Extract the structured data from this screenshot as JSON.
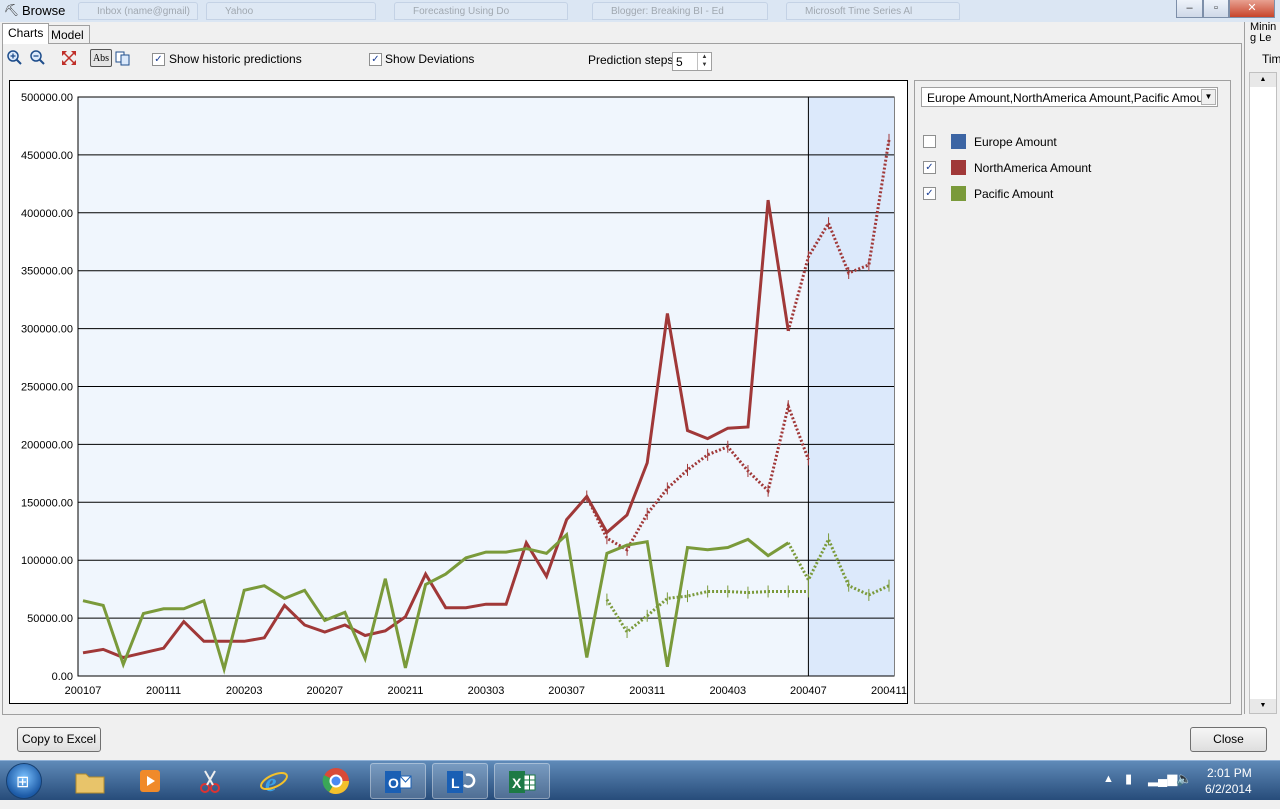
{
  "window": {
    "title": "Browse",
    "app_icon": "pickaxe-icon"
  },
  "background_tabs": [
    "Inbox (name@gmail)",
    "Yahoo",
    "Forecasting Using Do",
    "Blogger: Breaking BI - Ed",
    "Microsoft Time Series Al"
  ],
  "window_buttons": {
    "minimize": "–",
    "maximize": "▫",
    "close": "✕"
  },
  "tabs": [
    {
      "label": "Charts",
      "active": true
    },
    {
      "label": "Model",
      "active": false
    }
  ],
  "toolbar": {
    "zoom_in_icon": "zoom-in-icon",
    "zoom_out_icon": "zoom-out-icon",
    "fit_icon": "fit-icon",
    "abs_label": "Abs",
    "copy_icon": "copy-icon",
    "show_historic_label": "Show historic predictions",
    "show_historic_checked": true,
    "show_deviations_label": "Show Deviations",
    "show_deviations_checked": true,
    "prediction_steps_label": "Prediction steps",
    "prediction_steps_value": "5"
  },
  "legend": {
    "selector_value": "Europe Amount,NorthAmerica Amount,Pacific Amount",
    "items": [
      {
        "label": "Europe Amount",
        "checked": false,
        "color": "#3c65a4"
      },
      {
        "label": "NorthAmerica Amount",
        "checked": true,
        "color": "#a03838"
      },
      {
        "label": "Pacific Amount",
        "checked": true,
        "color": "#7a9a3a"
      }
    ]
  },
  "mini_panel": {
    "title_line1": "Minin",
    "title_line2": "g Le",
    "label": "Tim"
  },
  "buttons": {
    "copy_to_excel": "Copy to Excel",
    "close": "Close"
  },
  "taskbar": {
    "apps": [
      "explorer",
      "media-player",
      "snipping-tool",
      "internet-explorer",
      "chrome",
      "outlook",
      "lync",
      "excel"
    ],
    "time": "2:01 PM",
    "date": "6/2/2014"
  },
  "chart_data": {
    "type": "line",
    "ylim": [
      0,
      500000
    ],
    "y_ticks": [
      "500000.00",
      "450000.00",
      "400000.00",
      "350000.00",
      "300000.00",
      "250000.00",
      "200000.00",
      "150000.00",
      "100000.00",
      "50000.00",
      "0.00"
    ],
    "x_tick_labels": [
      "200107",
      "200111",
      "200203",
      "200207",
      "200211",
      "200303",
      "200307",
      "200311",
      "200403",
      "200407",
      "200411"
    ],
    "x": [
      "200107",
      "200108",
      "200109",
      "200110",
      "200111",
      "200112",
      "200201",
      "200202",
      "200203",
      "200204",
      "200205",
      "200206",
      "200207",
      "200208",
      "200209",
      "200210",
      "200211",
      "200212",
      "200301",
      "200302",
      "200303",
      "200304",
      "200305",
      "200306",
      "200307",
      "200308",
      "200309",
      "200310",
      "200311",
      "200312",
      "200401",
      "200402",
      "200403",
      "200404",
      "200405",
      "200406",
      "200407",
      "200408",
      "200409",
      "200410",
      "200411"
    ],
    "forecast_start": "200407",
    "series": [
      {
        "name": "NorthAmerica Amount",
        "color": "#a03838",
        "actual": [
          20000,
          23000,
          16000,
          20000,
          24000,
          47000,
          30000,
          30000,
          30000,
          33000,
          61000,
          44000,
          38000,
          44000,
          35000,
          39000,
          51000,
          88000,
          59000,
          59000,
          62000,
          62000,
          115000,
          86000,
          135000,
          155000,
          124000,
          139000,
          184000,
          313000,
          212000,
          205000,
          214000,
          215000,
          411000,
          298000
        ],
        "historic": [
          null,
          null,
          null,
          null,
          null,
          null,
          null,
          null,
          null,
          null,
          null,
          null,
          null,
          null,
          null,
          null,
          null,
          null,
          null,
          null,
          null,
          null,
          null,
          null,
          null,
          155000,
          119000,
          109000,
          140000,
          162000,
          178000,
          191000,
          198000,
          177000,
          160000,
          233000,
          187000
        ],
        "forecast": {
          "start_index": 35,
          "values": [
            298000,
            362000,
            391000,
            348000,
            355000,
            463000
          ]
        }
      },
      {
        "name": "Pacific Amount",
        "color": "#7a9a3a",
        "actual": [
          65000,
          61000,
          10000,
          54000,
          58000,
          58000,
          65000,
          6000,
          74000,
          78000,
          67000,
          74000,
          48000,
          55000,
          15000,
          84000,
          7000,
          79000,
          88000,
          102000,
          107000,
          107000,
          110000,
          106000,
          122000,
          16000,
          106000,
          113000,
          116000,
          8000,
          111000,
          109000,
          111000,
          118000,
          104000,
          115000
        ],
        "historic": [
          null,
          null,
          null,
          null,
          null,
          null,
          null,
          null,
          null,
          null,
          null,
          null,
          null,
          null,
          null,
          null,
          null,
          null,
          null,
          null,
          null,
          null,
          null,
          null,
          null,
          null,
          66000,
          38000,
          52000,
          67000,
          69000,
          73000,
          73000,
          72000,
          73000,
          73000,
          73000
        ],
        "forecast": {
          "start_index": 35,
          "values": [
            115000,
            83000,
            118000,
            78000,
            70000,
            78000
          ]
        }
      }
    ]
  }
}
